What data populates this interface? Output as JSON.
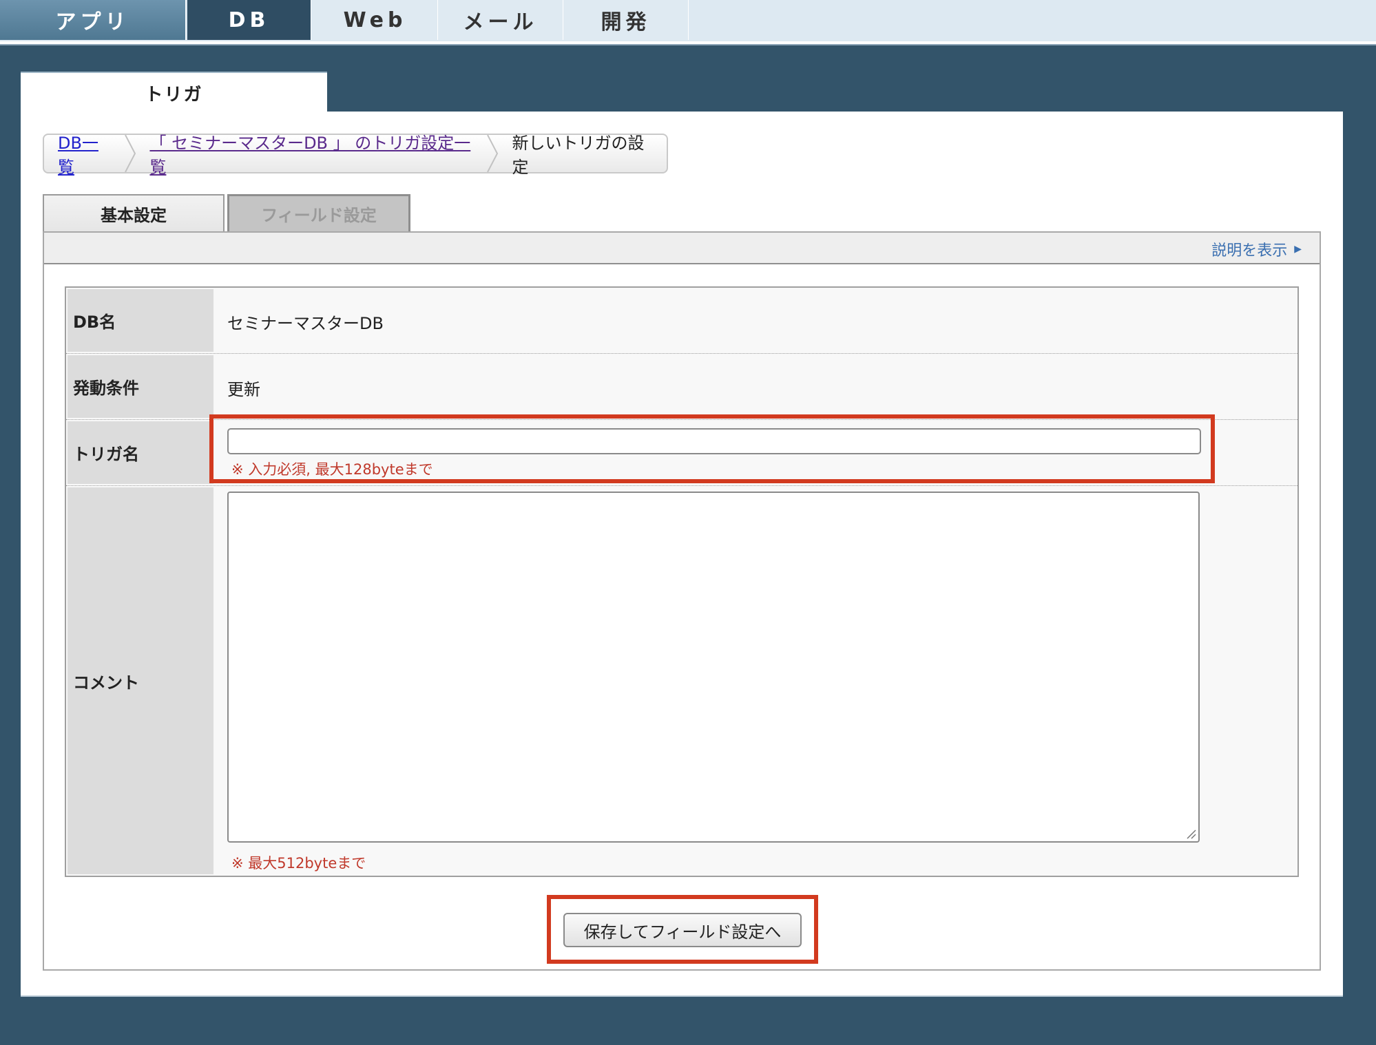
{
  "topnav": {
    "tabs": [
      {
        "label": "アプリ"
      },
      {
        "label": "DB"
      },
      {
        "label": "Web"
      },
      {
        "label": "メール"
      },
      {
        "label": "開発"
      }
    ]
  },
  "section": {
    "title": "トリガ"
  },
  "breadcrumb": {
    "items": [
      {
        "label": "DB一覧"
      },
      {
        "label": "「 セミナーマスターDB 」 のトリガ設定一覧"
      },
      {
        "label": "新しいトリガの設定"
      }
    ]
  },
  "tabs": {
    "basic": "基本設定",
    "field": "フィールド設定"
  },
  "help": {
    "label": "説明を表示"
  },
  "form": {
    "db_name_label": "DB名",
    "db_name_value": "セミナーマスターDB",
    "condition_label": "発動条件",
    "condition_value": "更新",
    "trigger_name_label": "トリガ名",
    "trigger_name_value": "",
    "trigger_name_note": "※ 入力必須, 最大128byteまで",
    "comment_label": "コメント",
    "comment_value": "",
    "comment_note": "※ 最大512byteまで"
  },
  "actions": {
    "save_label": "保存してフィールド設定へ"
  },
  "colors": {
    "highlight": "#d23a1f",
    "nav_dark": "#2f4d63",
    "background": "#33546a"
  }
}
